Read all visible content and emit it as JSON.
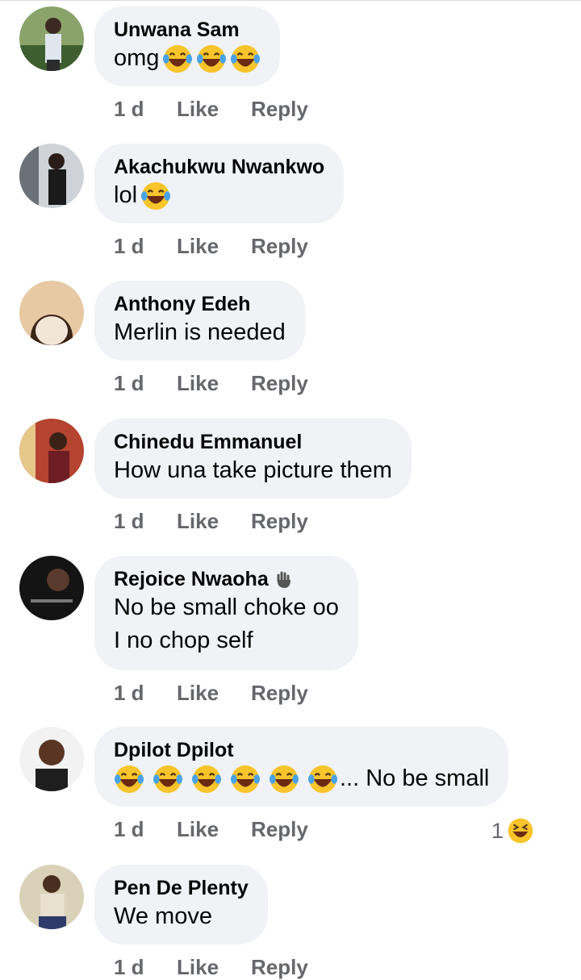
{
  "colors": {
    "bubble": "#f0f2f5",
    "meta": "#65676b",
    "text": "#050505",
    "emoji_yellow": "#f7c52b"
  },
  "action_labels": {
    "like": "Like",
    "reply": "Reply"
  },
  "comments": [
    {
      "name": "Unwana Sam",
      "lines": [
        "omg"
      ],
      "emoji": [
        "laugh-tears",
        "laugh-tears",
        "laugh-tears"
      ],
      "time": "1 d"
    },
    {
      "name": "Akachukwu Nwankwo",
      "lines": [
        "lol"
      ],
      "emoji": [
        "laugh-tears"
      ],
      "time": "1 d"
    },
    {
      "name": "Anthony Edeh",
      "lines": [
        "Merlin is needed"
      ],
      "time": "1 d"
    },
    {
      "name": "Chinedu Emmanuel",
      "lines": [
        "How una take picture them"
      ],
      "time": "1 d"
    },
    {
      "name": "Rejoice Nwaoha",
      "name_icon": "waving-hand-icon",
      "lines": [
        "No be small choke oo",
        "I no chop self"
      ],
      "time": "1 d"
    },
    {
      "name": "Dpilot Dpilot",
      "lines": [
        "... No be small"
      ],
      "emoji": [
        "laugh-tears",
        "laugh-tears",
        "laugh-tears",
        "laugh-tears",
        "laugh-tears",
        "laugh-tears"
      ],
      "time": "1 d",
      "reaction_count": "1",
      "reaction_icon": "laughing-squint-emoji"
    },
    {
      "name": "Pen De Plenty",
      "lines": [
        "We move"
      ],
      "time": "1 d"
    }
  ]
}
